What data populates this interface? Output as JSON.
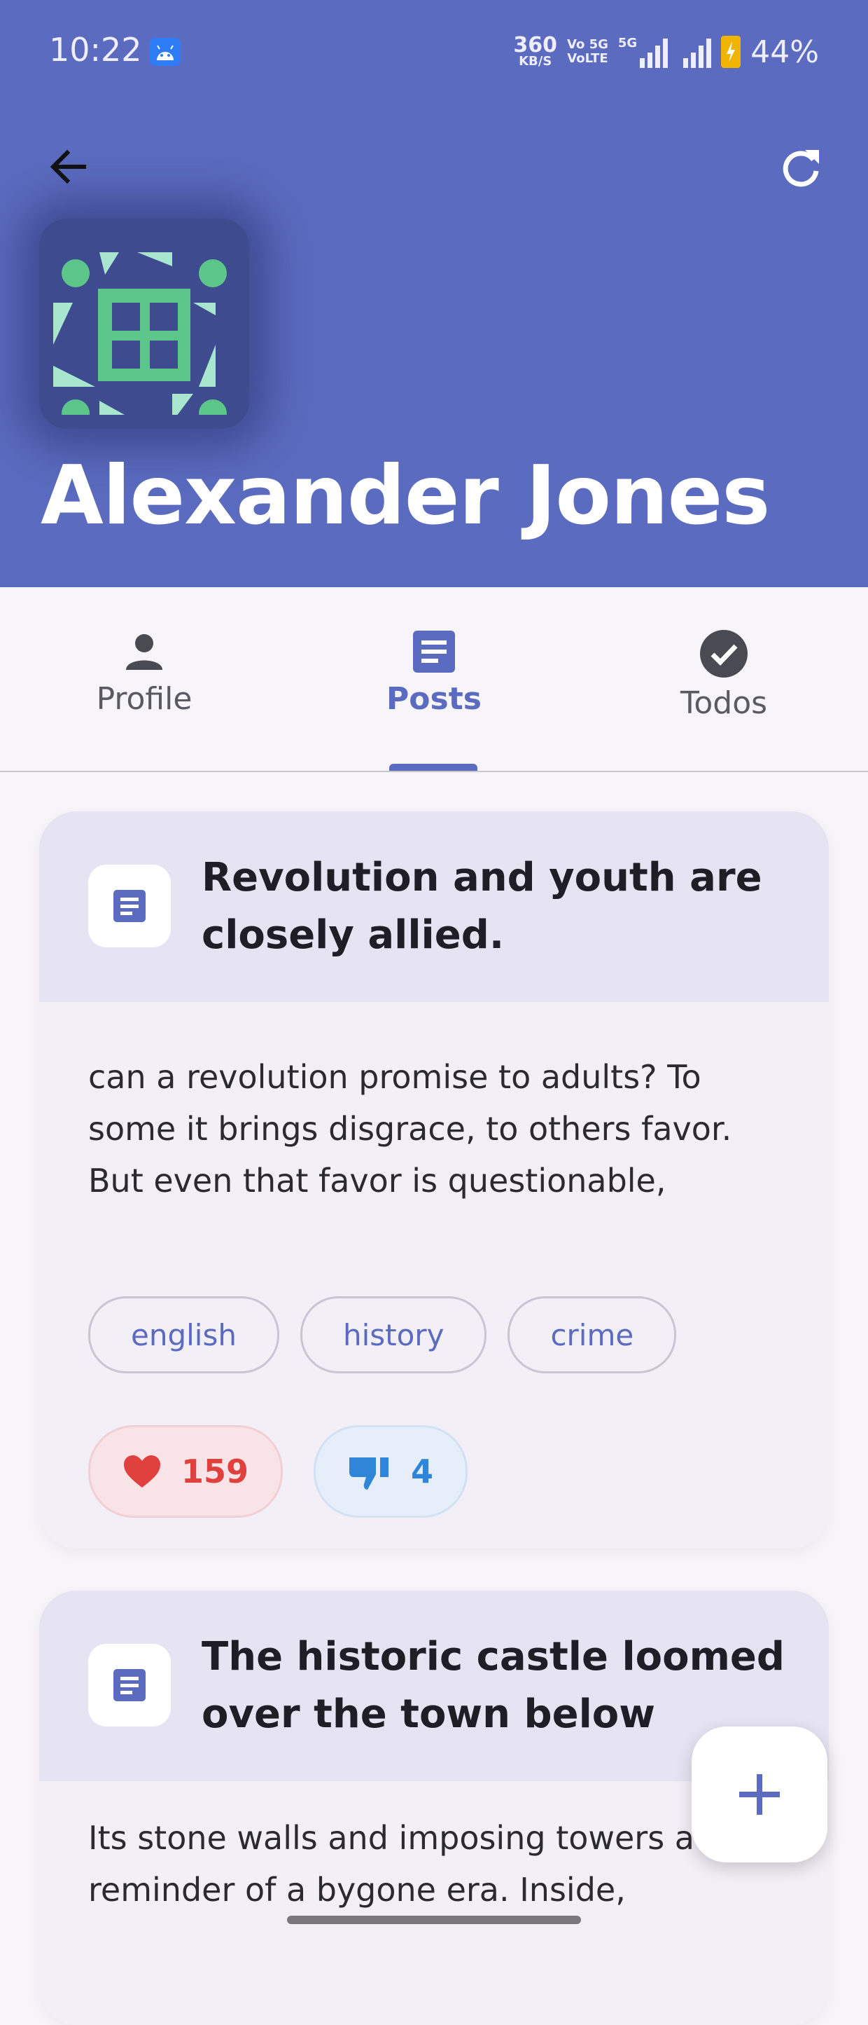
{
  "status_bar": {
    "time": "10:22",
    "net_speed_top": "360",
    "net_speed_bottom": "KB/S",
    "volte_top": "Vo 5G",
    "volte_bottom": "VoLTE",
    "network_type": "5G",
    "battery": "44%"
  },
  "header": {
    "back_icon": "arrow-left-icon",
    "refresh_icon": "refresh-icon",
    "user_name": "Alexander Jones",
    "colors": {
      "header_bg": "#5b6bbf",
      "avatar_green": "#5cc68a",
      "avatar_light": "#a8e6cf"
    }
  },
  "tabs": [
    {
      "label": "Profile",
      "icon": "person-icon",
      "active": false
    },
    {
      "label": "Posts",
      "icon": "document-icon",
      "active": true
    },
    {
      "label": "Todos",
      "icon": "check-circle-icon",
      "active": false
    }
  ],
  "posts": [
    {
      "title": "Revolution and youth are closely allied.",
      "body": "can a revolution promise to adults? To some it brings disgrace, to others favor. But even that favor is questionable,",
      "tags": [
        "english",
        "history",
        "crime"
      ],
      "likes": "159",
      "dislikes": "4"
    },
    {
      "title": "The historic castle loomed over the town below",
      "body": "Its stone walls and imposing towers a reminder of a bygone era. Inside,"
    }
  ],
  "fab": {
    "icon": "plus-icon"
  }
}
